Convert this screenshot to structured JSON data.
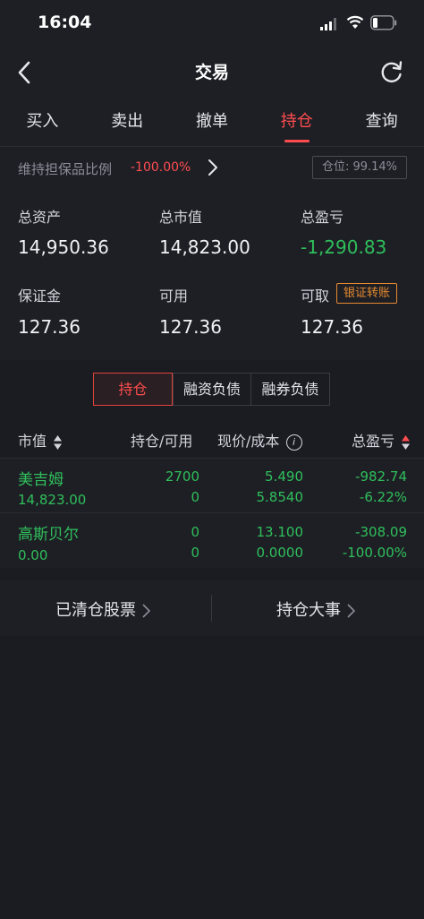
{
  "status": {
    "time": "16:04"
  },
  "nav": {
    "title": "交易"
  },
  "tabs": [
    {
      "label": "买入"
    },
    {
      "label": "卖出"
    },
    {
      "label": "撤单"
    },
    {
      "label": "持仓"
    },
    {
      "label": "查询"
    }
  ],
  "active_tab": "持仓",
  "account": {
    "ratio_label": "维持担保品比例",
    "ratio_value": "-100.00%",
    "position_label": "仓位: 99.14%",
    "total_assets_label": "总资产",
    "total_assets": "14,950.36",
    "market_value_label": "总市值",
    "market_value": "14,823.00",
    "total_pnl_label": "总盈亏",
    "total_pnl": "-1,290.83",
    "margin_label": "保证金",
    "margin": "127.36",
    "available_label": "可用",
    "available": "127.36",
    "withdrawable_label": "可取",
    "withdrawable": "127.36",
    "bank_transfer_label": "银证转账"
  },
  "segments": [
    {
      "label": "持仓"
    },
    {
      "label": "融资负债"
    },
    {
      "label": "融券负债"
    }
  ],
  "table": {
    "headers": {
      "market_value": "市值",
      "holding_available": "持仓/可用",
      "price_cost": "现价/成本",
      "total_pnl": "总盈亏"
    },
    "rows": [
      {
        "name": "美吉姆",
        "market_value": "14,823.00",
        "holding": "2700",
        "available": "0",
        "price": "5.490",
        "cost": "5.8540",
        "pnl": "-982.74",
        "pnl_pct": "-6.22%"
      },
      {
        "name": "高斯贝尔",
        "market_value": "0.00",
        "holding": "0",
        "available": "0",
        "price": "13.100",
        "cost": "0.0000",
        "pnl": "-308.09",
        "pnl_pct": "-100.00%"
      }
    ]
  },
  "footer": {
    "cleared_stocks": "已清仓股票",
    "position_events": "持仓大事"
  },
  "colors": {
    "accent_red": "#ff4d4f",
    "gain_green": "#2fbf5b",
    "transfer_orange": "#e58a2f",
    "background": "#1b1c22"
  },
  "icons": [
    "back-icon",
    "refresh-icon",
    "chevron-right-icon",
    "sort-icon",
    "info-icon",
    "signal-icon",
    "wifi-icon",
    "battery-icon"
  ]
}
